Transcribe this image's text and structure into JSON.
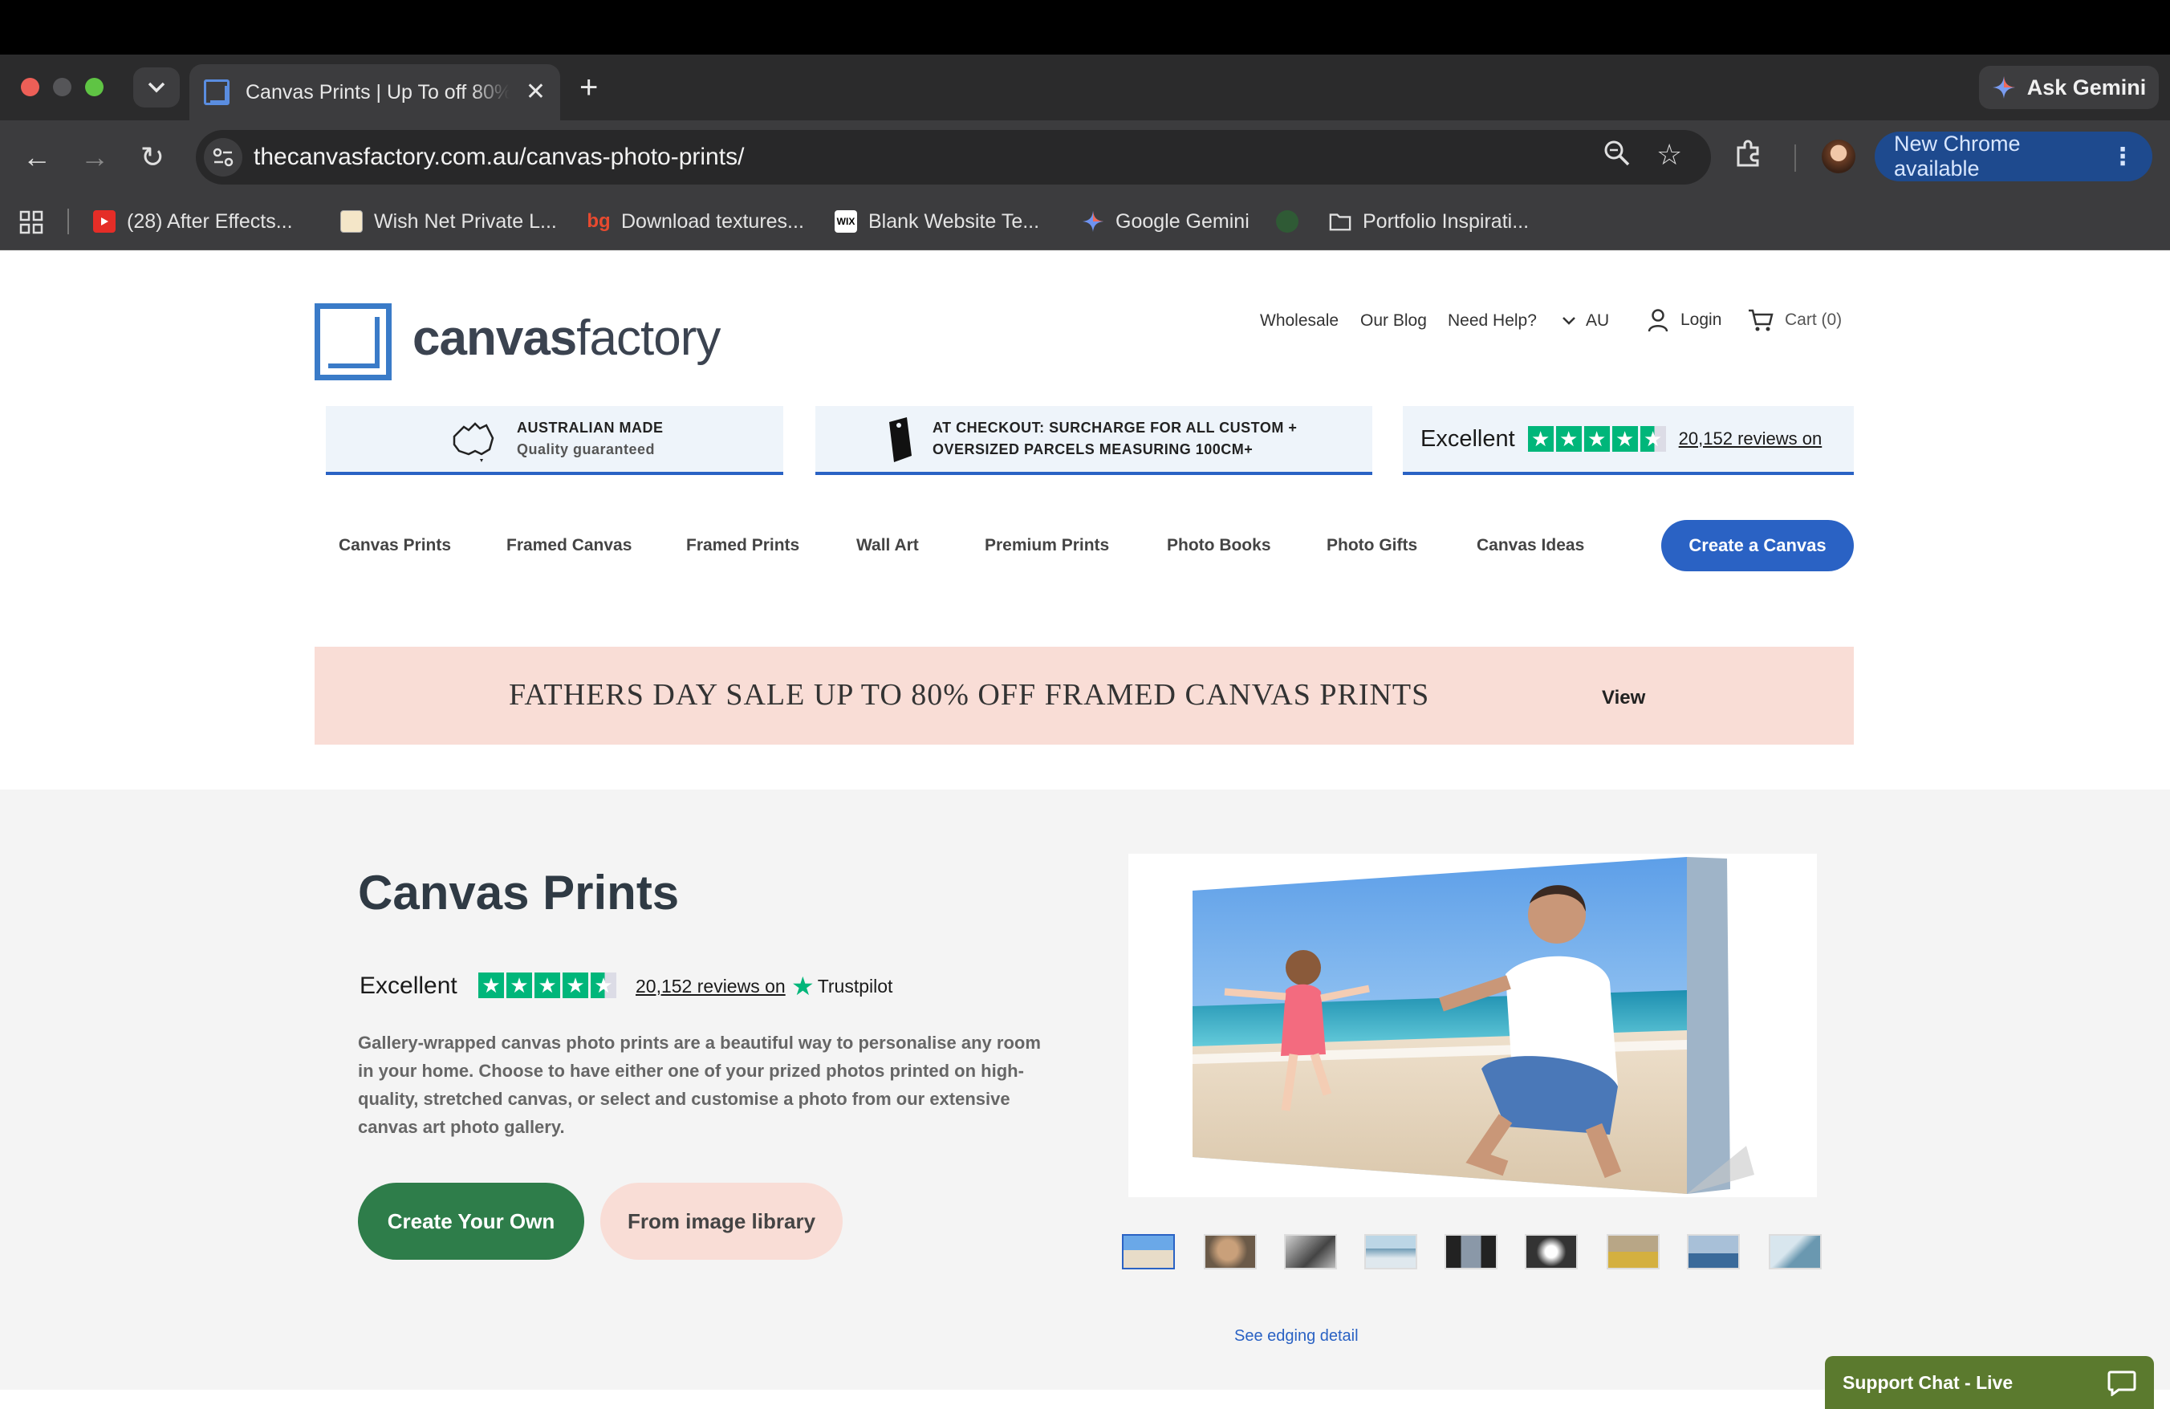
{
  "browser": {
    "tab_title": "Canvas Prints | Up To off 80%",
    "tab_close": "✕",
    "new_tab": "+",
    "gemini_label": "Ask Gemini",
    "url": "thecanvasfactory.com.au/canvas-photo-prints/",
    "update_label": "New Chrome available",
    "bookmarks": [
      {
        "label": "(28) After Effects..."
      },
      {
        "label": "Wish Net Private L..."
      },
      {
        "label": "Download textures..."
      },
      {
        "label": "Blank Website Te..."
      },
      {
        "label": "Google Gemini"
      },
      {
        "label": "Portfolio Inspirati..."
      }
    ],
    "bookmark_icons": {
      "bg": "bg",
      "wix": "WIX"
    }
  },
  "site": {
    "logo_bold": "canvas",
    "logo_light": "factory",
    "top_nav": {
      "wholesale": "Wholesale",
      "blog": "Our Blog",
      "help": "Need Help?",
      "region": "AU",
      "login": "Login",
      "cart": "Cart (0)"
    },
    "usp": {
      "made_title": "AUSTRALIAN MADE",
      "made_sub": "Quality guaranteed",
      "surcharge_line1": "AT CHECKOUT: SURCHARGE FOR ALL CUSTOM +",
      "surcharge_line2": "OVERSIZED PARCELS MEASURING 100CM+",
      "tp_excellent": "Excellent",
      "tp_reviews": "20,152 reviews on"
    },
    "main_nav": [
      "Canvas Prints",
      "Framed Canvas",
      "Framed Prints",
      "Wall Art",
      "Premium Prints",
      "Photo Books",
      "Photo Gifts",
      "Canvas Ideas"
    ],
    "cta": "Create a Canvas",
    "promo": {
      "text": "FATHERS DAY SALE UP TO 80% OFF FRAMED CANVAS PRINTS",
      "link": "View"
    },
    "hero": {
      "title": "Canvas Prints",
      "rating_word": "Excellent",
      "rating_stars": 4.5,
      "reviews": "20,152 reviews on",
      "trustpilot": "Trustpilot",
      "description": "Gallery-wrapped canvas photo prints are a beautiful way to personalise any room in your home. Choose to have either one of your prized photos printed on high-quality, stretched canvas, or select and customise a photo from our extensive canvas art photo gallery.",
      "btn_primary": "Create Your Own",
      "btn_secondary": "From image library",
      "edging_link": "See edging detail",
      "thumbnail_count": 9
    },
    "chat_label": "Support Chat - Live",
    "colors": {
      "brand_blue": "#2a62c4",
      "green_cta": "#2e7d4a",
      "promo_pink": "#f9ddd6",
      "trustpilot_green": "#00b67a",
      "chat_green": "#5b7a2e"
    }
  }
}
